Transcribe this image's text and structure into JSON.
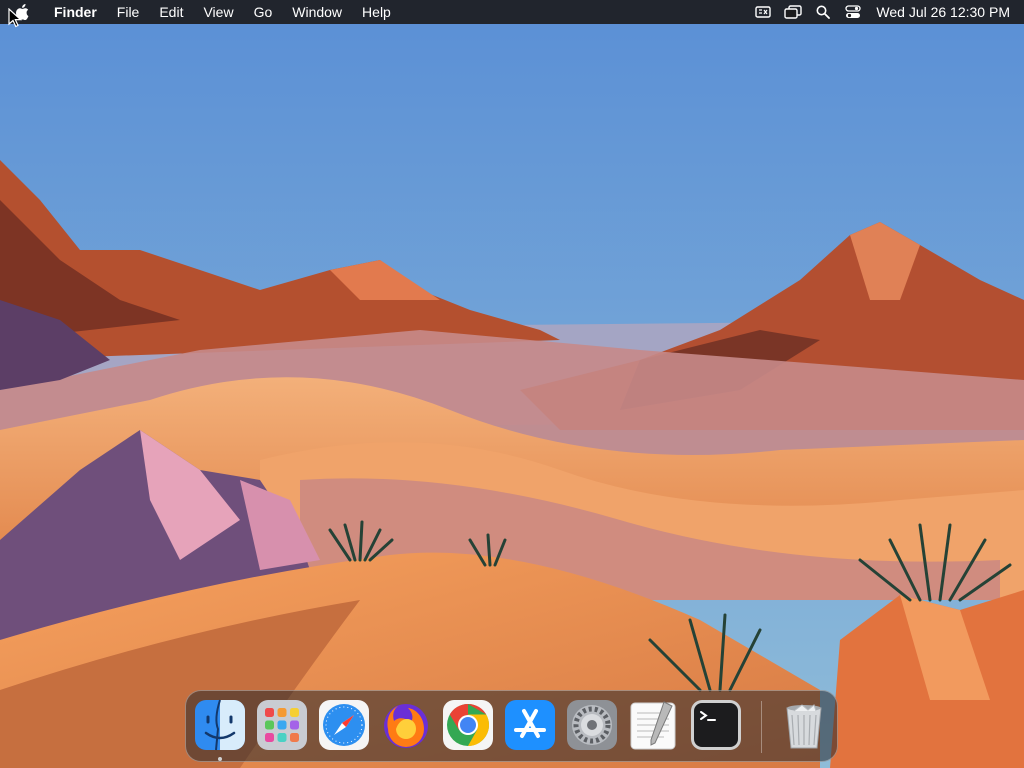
{
  "menubar": {
    "app_name": "Finder",
    "menus": [
      "File",
      "Edit",
      "View",
      "Go",
      "Window",
      "Help"
    ],
    "status_icons": [
      "keyboard-input-icon",
      "window-overlap-icon",
      "spotlight-search-icon",
      "control-center-icon"
    ],
    "clock": "Wed Jul 26  12:30 PM"
  },
  "dock": {
    "apps": [
      "finder-icon",
      "launchpad-icon",
      "safari-icon",
      "firefox-icon",
      "chrome-icon",
      "app-store-icon",
      "system-settings-icon",
      "textedit-icon",
      "terminal-icon",
      "trash-icon"
    ],
    "running": [
      "finder-icon"
    ]
  },
  "colors": {
    "sky_top": "#5b93d6",
    "sky_bottom": "#8bb8d9",
    "sand": "#e89a5e",
    "rock": "#a04a2c",
    "shadow": "#6e5a86"
  }
}
